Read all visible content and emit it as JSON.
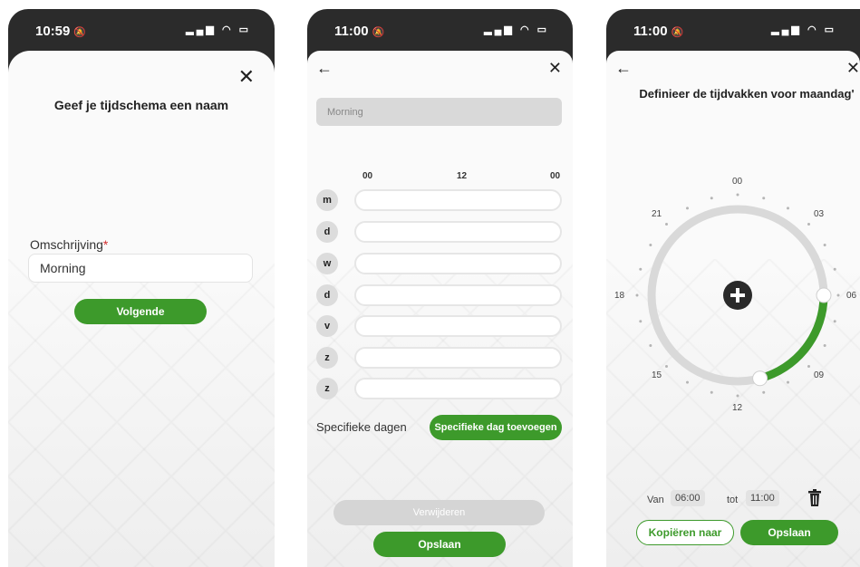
{
  "screen1": {
    "time": "10:59",
    "title": "Geef je tijdschema een naam",
    "field_label": "Omschrijving",
    "required_mark": "*",
    "field_value": "Morning",
    "next_button": "Volgende"
  },
  "screen2": {
    "time": "11:00",
    "schedule_name": "Morning",
    "hours": [
      "00",
      "12",
      "00"
    ],
    "days": [
      "m",
      "d",
      "w",
      "d",
      "v",
      "z",
      "z"
    ],
    "specific_label": "Specifieke dagen",
    "add_specific_button": "Specifieke dag toevoegen",
    "delete_button": "Verwijderen",
    "save_button": "Opslaan"
  },
  "screen3": {
    "time": "11:00",
    "title": "Definieer de tijdvakken voor maandag'",
    "clock_labels": [
      "00",
      "03",
      "06",
      "09",
      "12",
      "15",
      "18",
      "21"
    ],
    "selected_period": {
      "from": "06:00",
      "to": "11:00"
    },
    "from_label": "Van",
    "to_label": "tot",
    "from_value": "06:00",
    "to_value": "11:00",
    "copy_button": "Kopiëren naar",
    "save_button": "Opslaan"
  },
  "colors": {
    "accent": "#3d9a2b",
    "track": "#d9d9d9",
    "status_bar": "#2b2b2b"
  },
  "icons": {
    "close": "close-icon",
    "back": "back-arrow-icon",
    "add": "plus-circle-icon",
    "delete": "trash-icon"
  }
}
